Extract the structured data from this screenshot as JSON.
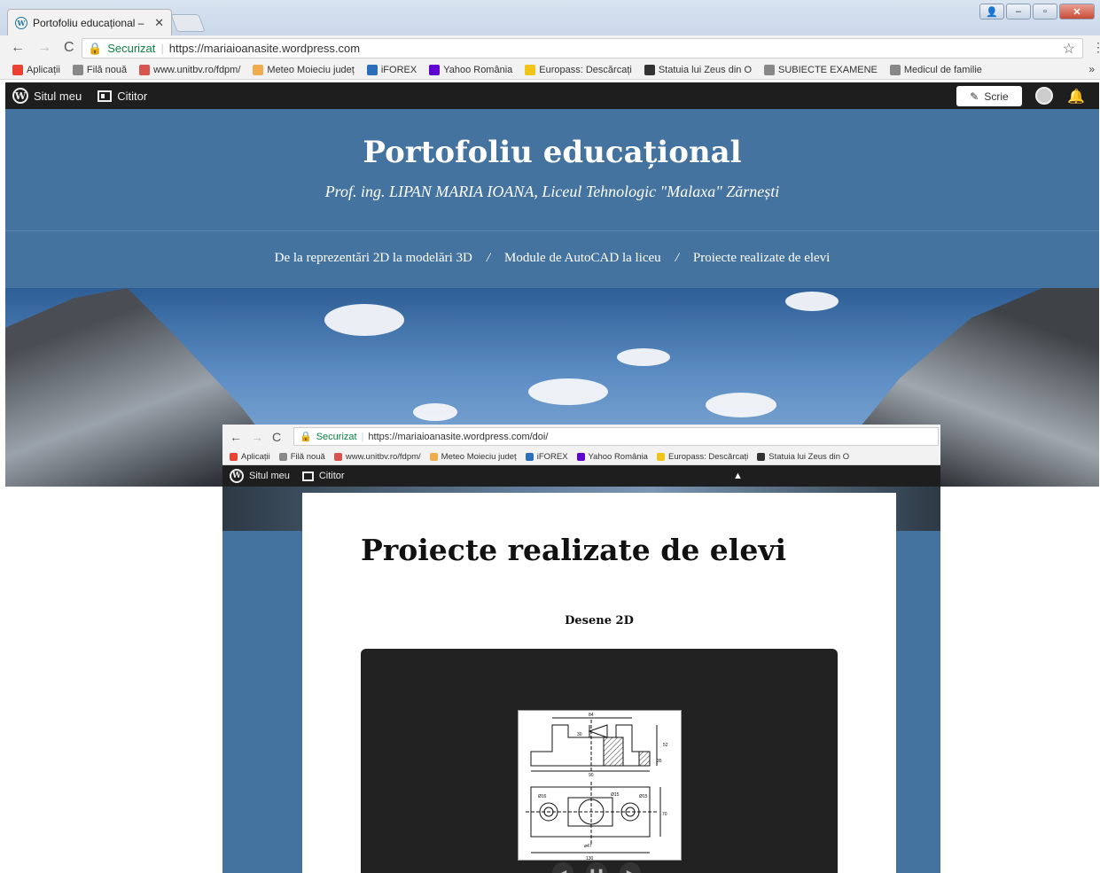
{
  "browser": {
    "tab_title": "Portofoliu educațional –",
    "tab_close": "✕",
    "security_label": "Securizat",
    "url": "https://mariaioanasite.wordpress.com",
    "bookmarks": [
      {
        "label": "Aplicații",
        "color": "#e94235"
      },
      {
        "label": "Filă nouă",
        "color": "#888888"
      },
      {
        "label": "www.unitbv.ro/fdpm/",
        "color": "#d9534f"
      },
      {
        "label": "Meteo Moieciu județ",
        "color": "#f0ad4e"
      },
      {
        "label": "iFOREX",
        "color": "#2a6fb8"
      },
      {
        "label": "Yahoo România",
        "color": "#5f01d1"
      },
      {
        "label": "Europass: Descărcați",
        "color": "#f0c419"
      },
      {
        "label": "Statuia lui Zeus din O",
        "color": "#333333"
      },
      {
        "label": "SUBIECTE EXAMENE",
        "color": "#888888"
      },
      {
        "label": "Medicul de familie",
        "color": "#888888"
      }
    ],
    "more_label": "»"
  },
  "admin_bar": {
    "my_site": "Situl meu",
    "reader": "Cititor",
    "write": "Scrie"
  },
  "site": {
    "title": "Portofoliu educațional",
    "tagline": "Prof. ing. LIPAN MARIA IOANA, Liceul Tehnologic \"Malaxa\" Zărnești",
    "nav": [
      "De la reprezentări 2D la modelări 3D",
      "Module de AutoCAD la liceu",
      "Proiecte realizate de elevi"
    ],
    "nav_separator": "/",
    "header_color": "#44739f"
  },
  "second_window": {
    "security_label": "Securizat",
    "url": "https://mariaioanasite.wordpress.com/doi/",
    "bookmarks": [
      "Aplicații",
      "Filă nouă",
      "www.unitbv.ro/fdpm/",
      "Meteo Moieciu județ",
      "iFOREX",
      "Yahoo România",
      "Europass: Descărcați",
      "Statuia lui Zeus din O"
    ],
    "my_site": "Situl meu",
    "reader": "Cititor",
    "page_title": "Proiecte realizate de elevi",
    "section_title": "Desene 2D",
    "drawing_dims": [
      "84",
      "90",
      "130",
      "Ø16",
      "Ø15",
      "Ø15",
      "35",
      "30",
      "52",
      "70",
      "ø47"
    ]
  }
}
